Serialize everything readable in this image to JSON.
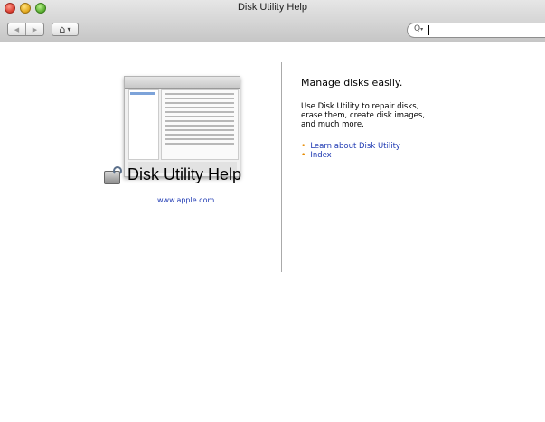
{
  "window": {
    "title": "Disk Utility Help"
  },
  "toolbar": {
    "back_glyph": "◀",
    "forward_glyph": "▶",
    "home_glyph": "⌂",
    "home_menu_glyph": "▾",
    "search_icon_glyph": "Q",
    "search_value": ""
  },
  "left": {
    "help_title": "Disk Utility Help",
    "link": "www.apple.com"
  },
  "right": {
    "heading": "Manage disks easily.",
    "body": "Use Disk Utility to repair disks, erase them, create disk images, and much more.",
    "links": [
      {
        "label": "Learn about Disk Utility"
      },
      {
        "label": "Index"
      }
    ]
  },
  "colors": {
    "link": "#1f3ab3",
    "bullet": "#e68a00"
  }
}
